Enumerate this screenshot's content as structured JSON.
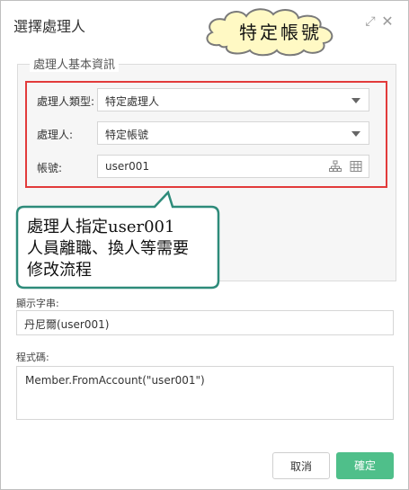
{
  "dialog": {
    "title": "選擇處理人",
    "group_title": "處理人基本資訊",
    "fields": {
      "type_label": "處理人類型:",
      "type_value": "特定處理人",
      "handler_label": "處理人:",
      "handler_value": "特定帳號",
      "account_label": "帳號:",
      "account_value": "user001"
    },
    "display_label": "顯示字串:",
    "display_value": "丹尼爾(user001)",
    "code_label": "程式碼:",
    "code_value": "Member.FromAccount(\"user001\")",
    "cancel_label": "取消",
    "ok_label": "確定"
  },
  "annotations": {
    "cloud_text": "特定帳號",
    "callout_lines": [
      "處理人指定user001",
      "人員離職、換人等需要",
      "修改流程"
    ]
  },
  "colors": {
    "highlight_red": "#e23b3b",
    "ok_green": "#4fbf8a",
    "callout_border": "#2e8b7a",
    "cloud_border": "#7a7a7a"
  }
}
